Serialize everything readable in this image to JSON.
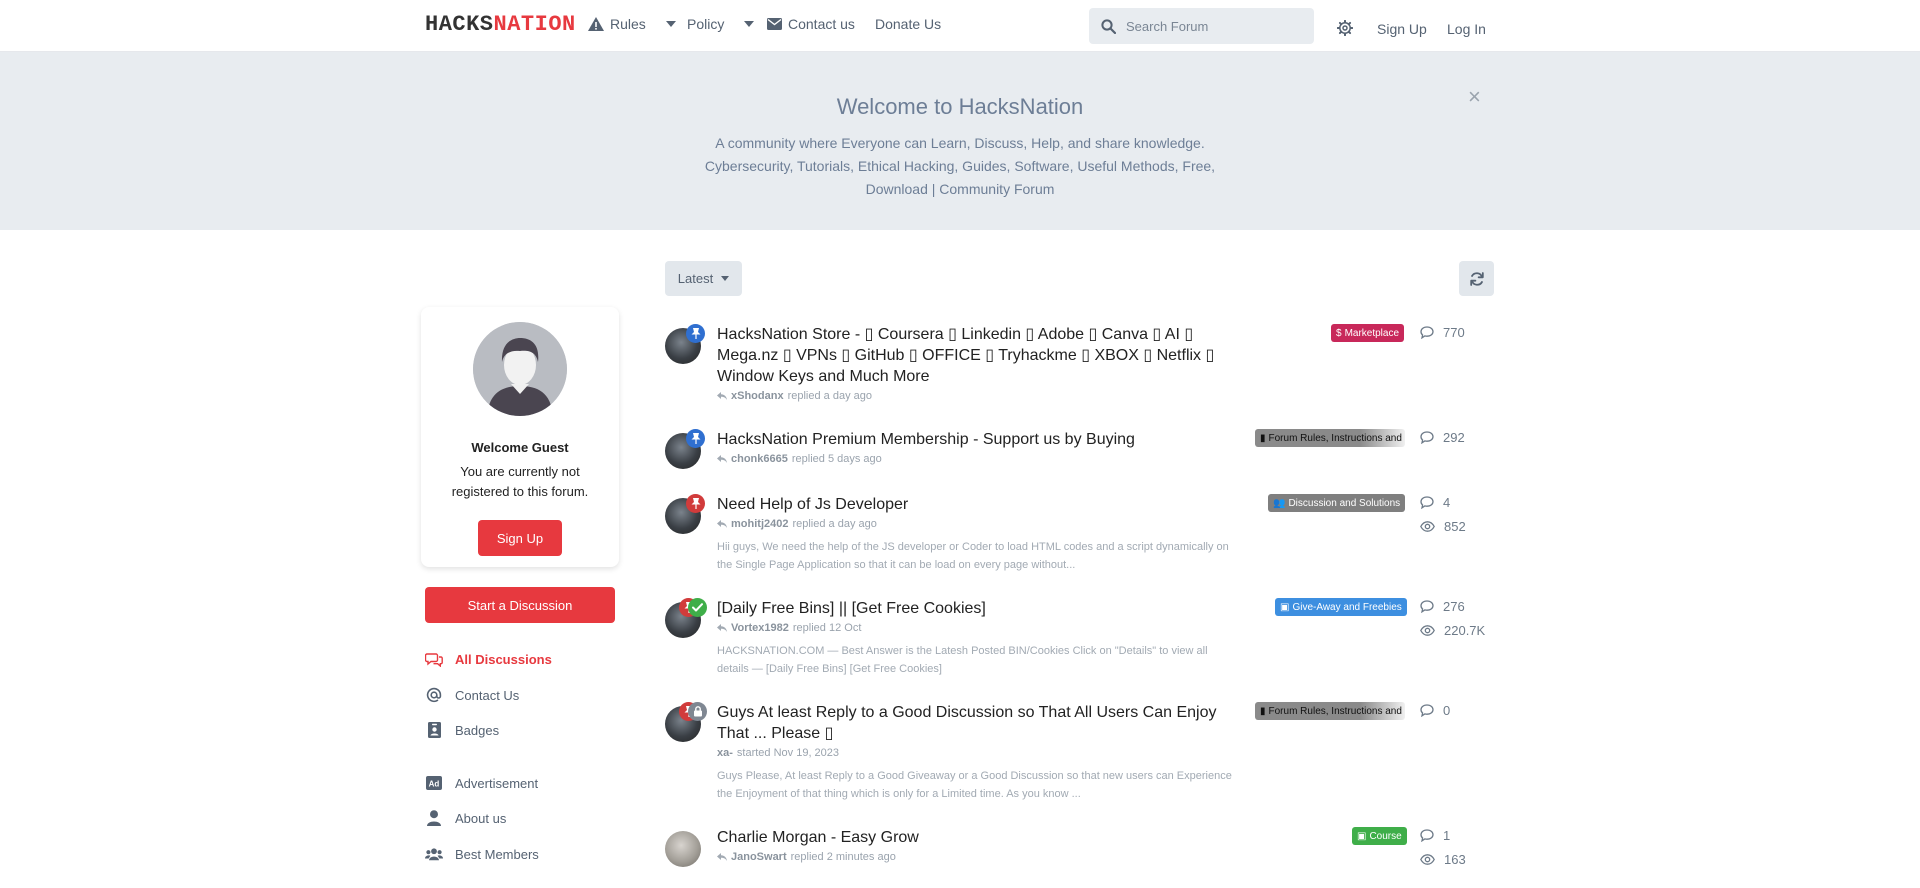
{
  "header": {
    "logo_a": "HACKS",
    "logo_b": "NATION",
    "nav": {
      "rules": "Rules",
      "policy": "Policy",
      "contact": "Contact us",
      "donate": "Donate Us"
    },
    "search_placeholder": "Search Forum",
    "signup": "Sign Up",
    "login": "Log In"
  },
  "hero": {
    "title": "Welcome to HacksNation",
    "description": "A community where Everyone can Learn, Discuss, Help, and share knowledge. Cybersecurity, Tutorials, Ethical Hacking, Guides, Software, Useful Methods, Free, Download | Community Forum",
    "close": "×"
  },
  "sidebar": {
    "welcome_title": "Welcome Guest",
    "welcome_text": "You are currently not registered to this forum.",
    "signup": "Sign Up",
    "start_discussion": "Start a Discussion",
    "items": [
      {
        "label": "All Discussions"
      },
      {
        "label": "Contact Us"
      },
      {
        "label": "Badges"
      },
      {
        "label": "Advertisement"
      },
      {
        "label": "About us"
      },
      {
        "label": "Best Members"
      }
    ]
  },
  "toolbar": {
    "sort": "Latest"
  },
  "discussions": [
    {
      "title": "HacksNation Store - ▯ Coursera ▯ Linkedin ▯ Adobe ▯ Canva ▯ AI ▯ Mega.nz ▯ VPNs ▯ GitHub ▯ OFFICE ▯ Tryhackme ▯ XBOX ▯ Netflix ▯ Window Keys and Much More",
      "user": "xShodanx",
      "action": "replied a day ago",
      "excerpt": "",
      "tag": "Marketplace",
      "tag_color": "#c8285a",
      "replies": "770",
      "views": ""
    },
    {
      "title": "HacksNation Premium Membership - Support us by Buying",
      "user": "chonk6665",
      "action": "replied 5 days ago",
      "excerpt": "",
      "tag": "Forum Rules, Instructions and",
      "tag_color": "#8a8a8a",
      "replies": "292",
      "views": ""
    },
    {
      "title": "Need Help of Js Developer",
      "user": "mohitj2402",
      "action": "replied a day ago",
      "excerpt": "Hii guys, We need the help of the JS developer or Coder to load HTML codes and a script dynamically on the Single Page Application so that it can be load on every page without...",
      "tag": "Discussion and Solutions",
      "tag_color": "#7f7f7f",
      "replies": "4",
      "views": "852"
    },
    {
      "title": "[Daily Free Bins] || [Get Free Cookies]",
      "user": "Vortex1982",
      "action": "replied 12 Oct",
      "excerpt": "HACKSNATION.COM — Best Answer is the Latesh Posted BIN/Cookies Click on \"Details\" to view all details — [Daily Free Bins] [Get Free Cookies]",
      "tag": "Give-Away and Freebies",
      "tag_color": "#3d8fe0",
      "replies": "276",
      "views": "220.7K"
    },
    {
      "title": "Guys At least Reply to a Good Discussion so That All Users Can Enjoy That ... Please ▯",
      "user": "xa-",
      "action": "started Nov 19, 2023",
      "excerpt": "Guys Please, At least Reply to a Good Giveaway or a Good Discussion so that new users can Experience the Enjoyment of that thing which is only for a Limited time. As you know ...",
      "tag": "Forum Rules, Instructions and",
      "tag_color": "#8a8a8a",
      "replies": "0",
      "views": ""
    },
    {
      "title": "Charlie Morgan - Easy Grow",
      "user": "JanoSwart",
      "action": "replied 2 minutes ago",
      "excerpt": "",
      "tag": "Course",
      "tag_color": "#3fae49",
      "replies": "1",
      "views": "163"
    }
  ]
}
